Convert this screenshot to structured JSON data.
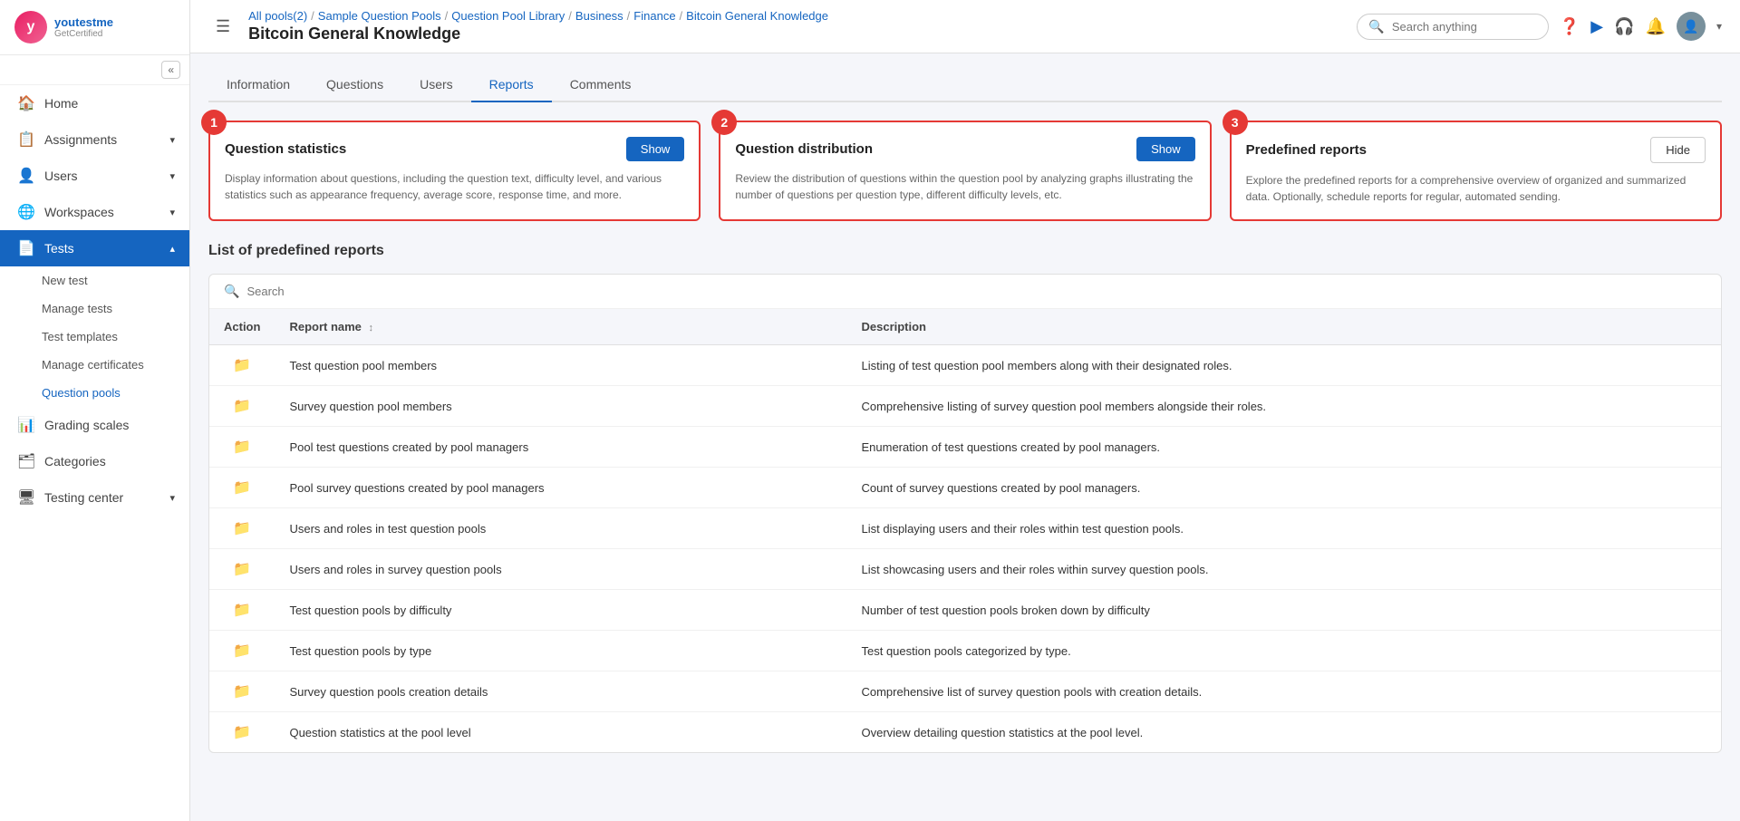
{
  "logo": {
    "text": "youtestme",
    "sub": "GetCertified"
  },
  "sidebar": {
    "collapse_label": "«",
    "nav_items": [
      {
        "id": "home",
        "icon": "🏠",
        "label": "Home",
        "active": false
      },
      {
        "id": "assignments",
        "icon": "📋",
        "label": "Assignments",
        "active": false,
        "has_arrow": true
      },
      {
        "id": "users",
        "icon": "👤",
        "label": "Users",
        "active": false,
        "has_arrow": true
      },
      {
        "id": "workspaces",
        "icon": "🌐",
        "label": "Workspaces",
        "active": false,
        "has_arrow": true
      },
      {
        "id": "tests",
        "icon": "📄",
        "label": "Tests",
        "active": true,
        "has_arrow": true
      }
    ],
    "sub_items": [
      {
        "id": "new-test",
        "label": "New test",
        "active": false
      },
      {
        "id": "manage-tests",
        "label": "Manage tests",
        "active": false
      },
      {
        "id": "test-templates",
        "label": "Test templates",
        "active": false
      },
      {
        "id": "manage-certificates",
        "label": "Manage certificates",
        "active": false
      },
      {
        "id": "question-pools",
        "label": "Question pools",
        "active": true
      }
    ],
    "bottom_items": [
      {
        "id": "grading-scales",
        "icon": "📊",
        "label": "Grading scales",
        "active": false,
        "has_arrow": false
      },
      {
        "id": "categories",
        "icon": "🗂",
        "label": "Categories",
        "active": false,
        "has_arrow": false
      },
      {
        "id": "testing-center",
        "icon": "🖥",
        "label": "Testing center",
        "active": false,
        "has_arrow": true
      }
    ]
  },
  "topbar": {
    "breadcrumbs": [
      {
        "label": "All pools(2)",
        "href": "#"
      },
      {
        "label": "Sample Question Pools",
        "href": "#"
      },
      {
        "label": "Question Pool Library",
        "href": "#"
      },
      {
        "label": "Business",
        "href": "#"
      },
      {
        "label": "Finance",
        "href": "#"
      },
      {
        "label": "Bitcoin General Knowledge",
        "href": "#",
        "current": true
      }
    ],
    "page_title": "Bitcoin General Knowledge",
    "search_placeholder": "Search anything"
  },
  "tabs": [
    {
      "id": "information",
      "label": "Information",
      "active": false
    },
    {
      "id": "questions",
      "label": "Questions",
      "active": false
    },
    {
      "id": "users",
      "label": "Users",
      "active": false
    },
    {
      "id": "reports",
      "label": "Reports",
      "active": true
    },
    {
      "id": "comments",
      "label": "Comments",
      "active": false
    }
  ],
  "cards": [
    {
      "number": "1",
      "title": "Question statistics",
      "btn_label": "Show",
      "btn_type": "show",
      "desc": "Display information about questions, including the question text, difficulty level, and various statistics such as appearance frequency, average score, response time, and more."
    },
    {
      "number": "2",
      "title": "Question distribution",
      "btn_label": "Show",
      "btn_type": "show",
      "desc": "Review the distribution of questions within the question pool by analyzing graphs illustrating the number of questions per question type, different difficulty levels, etc."
    },
    {
      "number": "3",
      "title": "Predefined reports",
      "btn_label": "Hide",
      "btn_type": "hide",
      "desc": "Explore the predefined reports for a comprehensive overview of organized and summarized data. Optionally, schedule reports for regular, automated sending."
    }
  ],
  "predefined_reports": {
    "section_title": "List of predefined reports",
    "search_placeholder": "Search",
    "columns": [
      {
        "id": "action",
        "label": "Action"
      },
      {
        "id": "report_name",
        "label": "Report name",
        "sortable": true
      },
      {
        "id": "description",
        "label": "Description"
      }
    ],
    "rows": [
      {
        "report_name": "Test question pool members",
        "description": "Listing of test question pool members along with their designated roles."
      },
      {
        "report_name": "Survey question pool members",
        "description": "Comprehensive listing of survey question pool members alongside their roles."
      },
      {
        "report_name": "Pool test questions created by pool managers",
        "description": "Enumeration of test questions created by pool managers."
      },
      {
        "report_name": "Pool survey questions created by pool managers",
        "description": "Count of survey questions created by pool managers."
      },
      {
        "report_name": "Users and roles in test question pools",
        "description": "List displaying users and their roles within test question pools."
      },
      {
        "report_name": "Users and roles in survey question pools",
        "description": "List showcasing users and their roles within survey question pools."
      },
      {
        "report_name": "Test question pools by difficulty",
        "description": "Number of test question pools broken down by difficulty"
      },
      {
        "report_name": "Test question pools by type",
        "description": "Test question pools categorized by type."
      },
      {
        "report_name": "Survey question pools creation details",
        "description": "Comprehensive list of survey question pools with creation details."
      },
      {
        "report_name": "Question statistics at the pool level",
        "description": "Overview detailing question statistics at the pool level."
      }
    ]
  }
}
